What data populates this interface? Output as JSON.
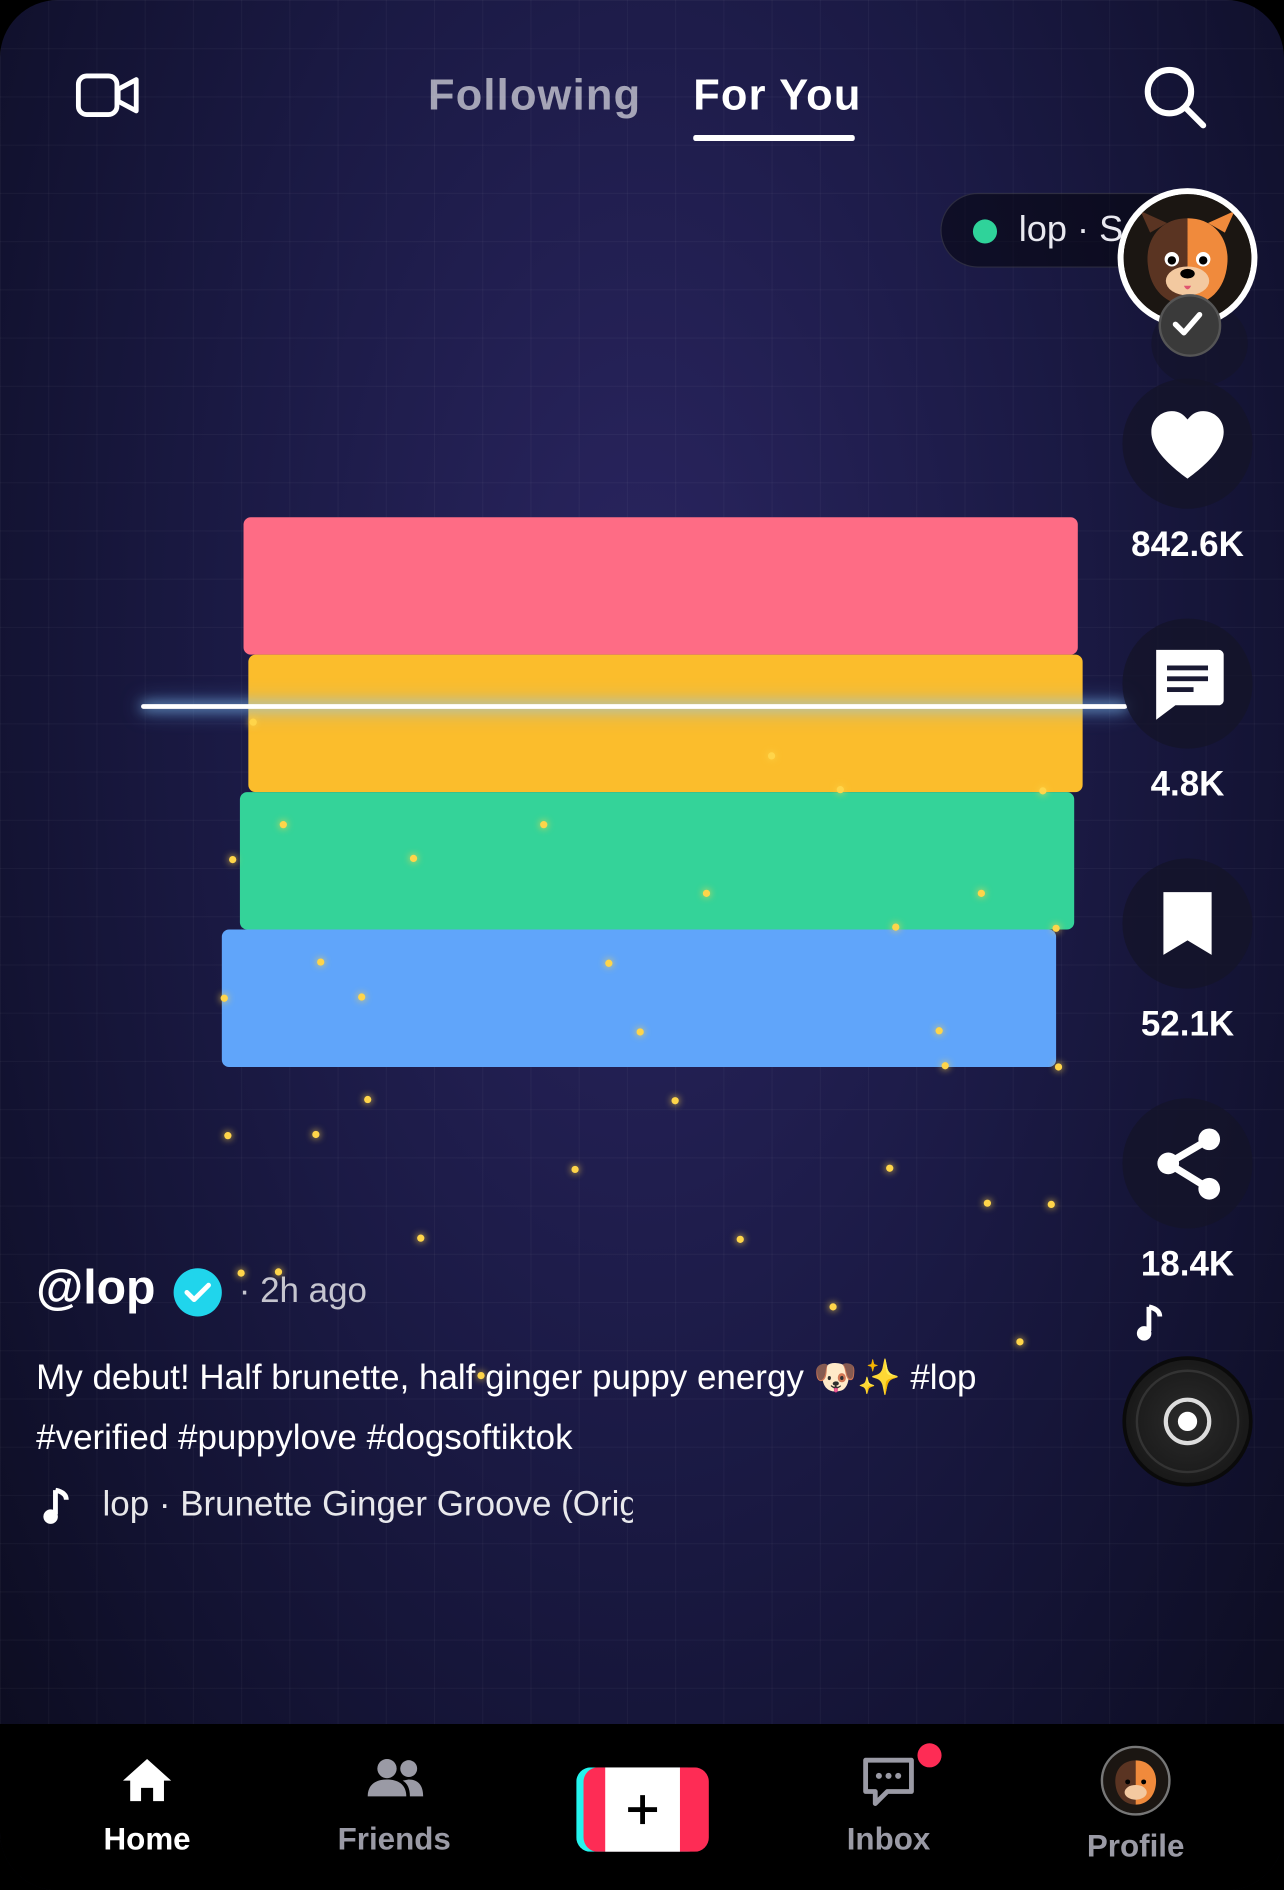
{
  "top_nav": {
    "tabs": [
      {
        "label": "Following",
        "active": false
      },
      {
        "label": "For You",
        "active": true
      }
    ],
    "live_icon": "video-camera-icon",
    "search_icon": "search-icon"
  },
  "live_pill": {
    "text": "lop · S",
    "dot_color": "#2fd39a"
  },
  "creator_avatar": {
    "icon": "dog-avatar",
    "follow_state_icon": "check-icon"
  },
  "actions": [
    {
      "name": "like",
      "icon": "heart-icon",
      "count": "842.6K"
    },
    {
      "name": "comment",
      "icon": "comment-icon",
      "count": "4.8K"
    },
    {
      "name": "save",
      "icon": "bookmark-icon",
      "count": "52.1K"
    },
    {
      "name": "share",
      "icon": "share-icon",
      "count": "18.4K"
    }
  ],
  "video": {
    "stripe_colors": [
      "#fe6c85",
      "#fbbd2c",
      "#34d399",
      "#60a5fa"
    ]
  },
  "post": {
    "username": "@lop",
    "verified": true,
    "time_ago": "· 2h ago",
    "caption": "My debut! Half brunette, half ginger puppy energy 🐶✨ #lop #verified #puppylove #dogsoftiktok",
    "music": "lop · Brunette Ginger Groove (Original Sound)"
  },
  "bottom_nav": {
    "items": [
      {
        "label": "Home",
        "icon": "home-icon",
        "active": true
      },
      {
        "label": "Friends",
        "icon": "friends-icon",
        "active": false
      },
      {
        "label": "",
        "icon": "plus-icon",
        "active": false
      },
      {
        "label": "Inbox",
        "icon": "inbox-icon",
        "active": false,
        "badge": true
      },
      {
        "label": "Profile",
        "icon": "profile-avatar-icon",
        "active": false
      }
    ],
    "accent_colors": {
      "cyan": "#25f4ee",
      "red": "#fe2c55"
    }
  }
}
